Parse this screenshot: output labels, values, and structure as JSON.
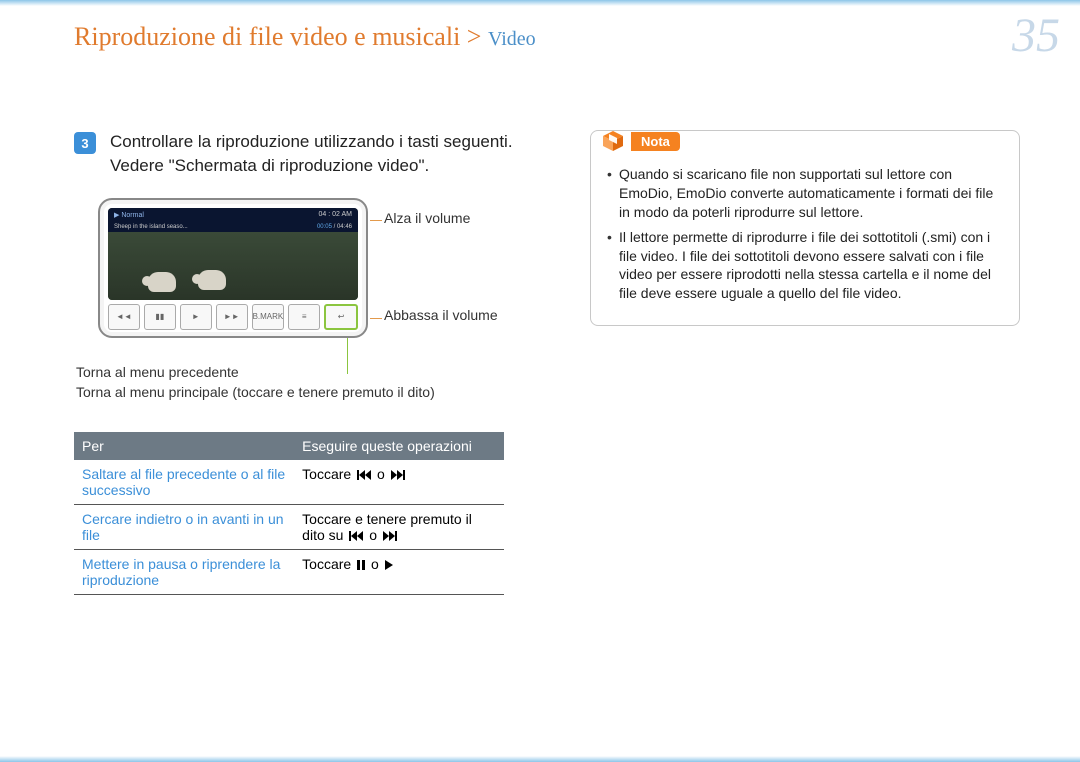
{
  "page_number": "35",
  "breadcrumb": {
    "main": "Riproduzione di file video e musicali >",
    "sub": "Video"
  },
  "step": {
    "number": "3",
    "text": "Controllare la riproduzione utilizzando i tasti seguenti. Vedere \"Schermata di riproduzione video\"."
  },
  "device": {
    "status_left": "▶  Normal",
    "status_right": "04 : 02 AM",
    "title_line": "Sheep in the island seaso...",
    "time_current": "00:05",
    "time_total": "/ 04:46",
    "controls": [
      "◄◄",
      "▮▮",
      "►",
      "►►",
      "B.MARK",
      "≡",
      "↩"
    ]
  },
  "callouts": {
    "volume_up": "Alza il volume",
    "volume_down": "Abbassa il volume",
    "back_prev": "Torna al menu precedente",
    "back_main": "Torna al menu principale (toccare e tenere premuto il dito)"
  },
  "table": {
    "header_left": "Per",
    "header_right": "Eseguire queste operazioni",
    "rows": [
      {
        "action": "Saltare al file precedente o al file successivo",
        "op_prefix": "Toccare ",
        "op_mid": " o ",
        "icon1": "prev",
        "icon2": "next"
      },
      {
        "action": "Cercare indietro o in avanti in un file",
        "op_prefix": "Toccare e tenere premuto il dito su ",
        "op_mid": " o ",
        "icon1": "prev",
        "icon2": "next"
      },
      {
        "action": "Mettere in pausa o riprendere la riproduzione",
        "op_prefix": "Toccare ",
        "op_mid": " o ",
        "icon1": "pause",
        "icon2": "play"
      }
    ]
  },
  "nota": {
    "label": "Nota",
    "items": [
      "Quando si scaricano file non supportati sul lettore con EmoDio, EmoDio converte automaticamente i formati dei file in modo da poterli riprodurre sul lettore.",
      "Il lettore permette di riprodurre i file dei sottotitoli (.smi) con i file video. I file dei sottotitoli devono essere salvati con i file video per essere riprodotti nella stessa cartella e il nome del file deve essere uguale a quello del file video."
    ]
  }
}
